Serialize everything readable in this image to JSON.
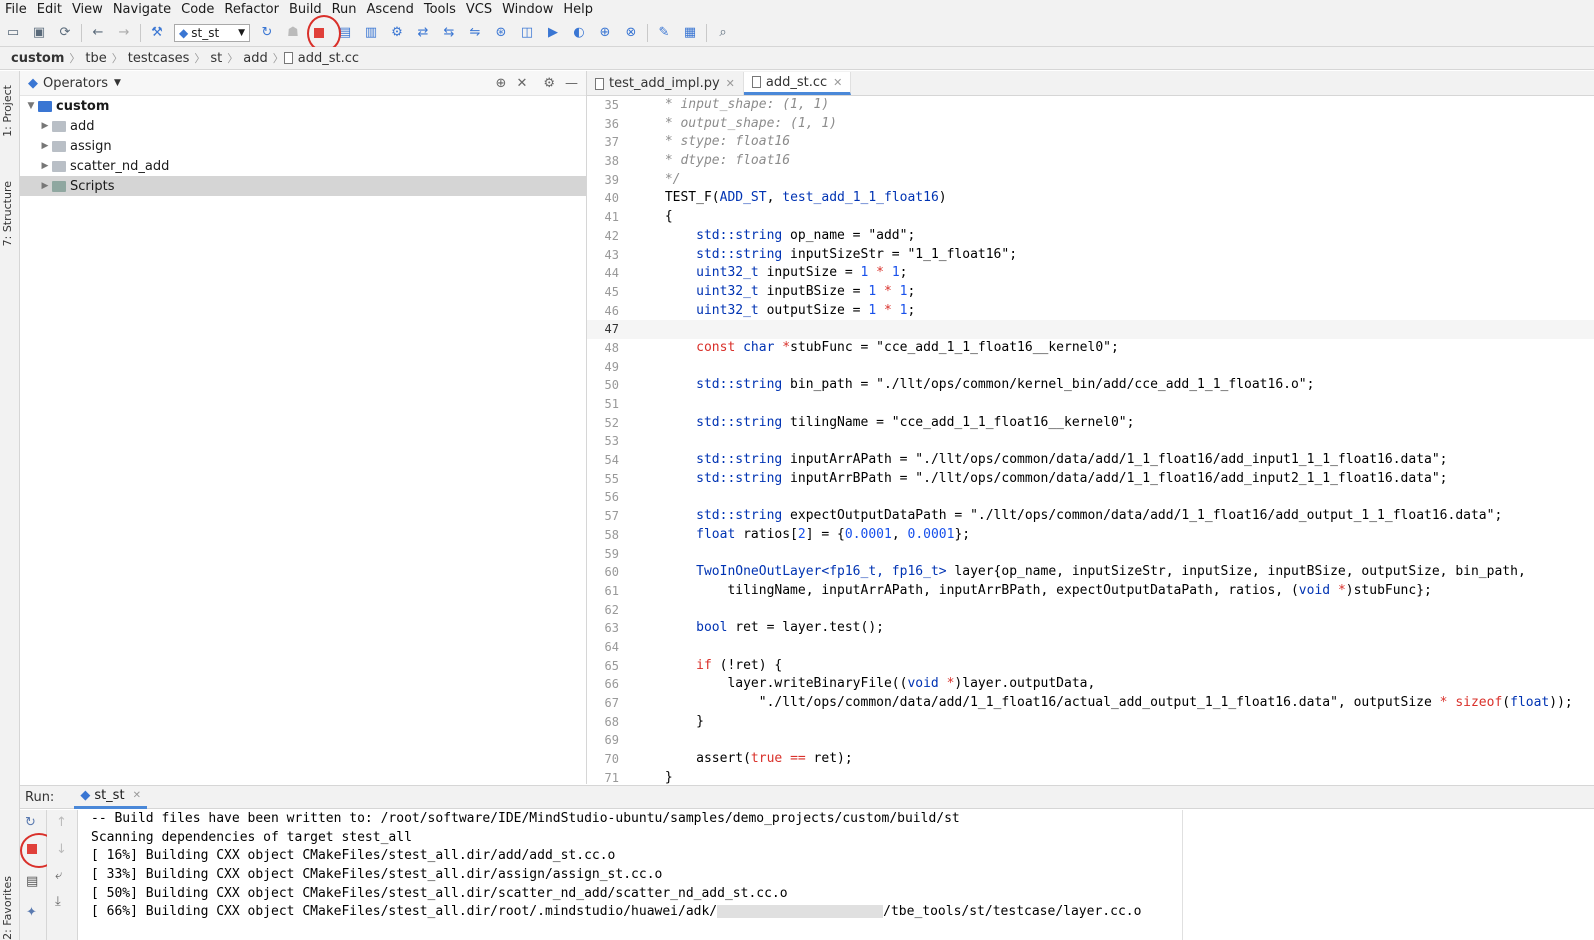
{
  "menu": [
    "File",
    "Edit",
    "View",
    "Navigate",
    "Code",
    "Refactor",
    "Build",
    "Run",
    "Ascend",
    "Tools",
    "VCS",
    "Window",
    "Help"
  ],
  "toolbar": {
    "run_config": "st_st",
    "icons": [
      "open-icon",
      "save-icon",
      "sync-icon",
      "back-icon",
      "forward-icon",
      "build-hammer-icon",
      "run-icon",
      "debug-icon",
      "stop-icon",
      "model-converter-icon",
      "dump-icon",
      "profiling-icon",
      "tuning-icon",
      "plugin-icon",
      "ais-icon",
      "ascend-icon",
      "tracing-icon",
      "sampling-icon",
      "monitor-icon",
      "dev-icon",
      "zoom-icon",
      "settings-wrench-icon",
      "project-structure-icon",
      "search-icon"
    ]
  },
  "breadcrumb": [
    "custom",
    "tbe",
    "testcases",
    "st",
    "add",
    "add_st.cc"
  ],
  "left_strip": {
    "project_tab": "1: Project",
    "structure_tab": "7: Structure",
    "favorites_tab": "2: Favorites"
  },
  "project": {
    "header": "Operators",
    "root": "custom",
    "items": [
      "add",
      "assign",
      "scatter_nd_add",
      "Scripts"
    ]
  },
  "editor": {
    "tabs": [
      "test_add_impl.py",
      "add_st.cc"
    ],
    "lines": [
      {
        "n": "35",
        "html": "<span class='c-cmt'> * input_shape: (1, 1)</span>"
      },
      {
        "n": "36",
        "html": "<span class='c-cmt'> * output_shape: (1, 1)</span>"
      },
      {
        "n": "37",
        "html": "<span class='c-cmt'> * stype: float16</span>"
      },
      {
        "n": "38",
        "html": "<span class='c-cmt'> * dtype: float16</span>"
      },
      {
        "n": "39",
        "html": "<span class='c-cmt'> */</span>"
      },
      {
        "n": "40",
        "html": " TEST_F(<span class='c-type'>ADD_ST</span>, <span class='c-type'>test_add_1_1_float16</span>)"
      },
      {
        "n": "41",
        "html": " {"
      },
      {
        "n": "42",
        "html": "     <span class='c-type'>std::string</span> op_name = \"add\";"
      },
      {
        "n": "43",
        "html": "     <span class='c-type'>std::string</span> inputSizeStr = \"1_1_float16\";"
      },
      {
        "n": "44",
        "html": "     <span class='c-type'>uint32_t</span> inputSize = <span class='c-num'>1</span> <span class='c-kw'>*</span> <span class='c-num'>1</span>;"
      },
      {
        "n": "45",
        "html": "     <span class='c-type'>uint32_t</span> inputBSize = <span class='c-num'>1</span> <span class='c-kw'>*</span> <span class='c-num'>1</span>;"
      },
      {
        "n": "46",
        "html": "     <span class='c-type'>uint32_t</span> outputSize = <span class='c-num'>1</span> <span class='c-kw'>*</span> <span class='c-num'>1</span>;"
      },
      {
        "n": "47",
        "html": "",
        "current": true
      },
      {
        "n": "48",
        "html": "     <span class='c-kw'>const</span> <span class='c-type'>char</span> <span class='c-kw'>*</span>stubFunc = \"cce_add_1_1_float16__kernel0\";"
      },
      {
        "n": "49",
        "html": ""
      },
      {
        "n": "50",
        "html": "     <span class='c-type'>std::string</span> bin_path = \"./llt/ops/common/kernel_bin/add/cce_add_1_1_float16.o\";"
      },
      {
        "n": "51",
        "html": ""
      },
      {
        "n": "52",
        "html": "     <span class='c-type'>std::string</span> tilingName = \"cce_add_1_1_float16__kernel0\";"
      },
      {
        "n": "53",
        "html": ""
      },
      {
        "n": "54",
        "html": "     <span class='c-type'>std::string</span> inputArrAPath = \"./llt/ops/common/data/add/1_1_float16/add_input1_1_1_float16.data\";"
      },
      {
        "n": "55",
        "html": "     <span class='c-type'>std::string</span> inputArrBPath = \"./llt/ops/common/data/add/1_1_float16/add_input2_1_1_float16.data\";"
      },
      {
        "n": "56",
        "html": ""
      },
      {
        "n": "57",
        "html": "     <span class='c-type'>std::string</span> expectOutputDataPath = \"./llt/ops/common/data/add/1_1_float16/add_output_1_1_float16.data\";"
      },
      {
        "n": "58",
        "html": "     <span class='c-type'>float</span> ratios[<span class='c-num'>2</span>] = {<span class='c-num'>0.0001</span>, <span class='c-num'>0.0001</span>};"
      },
      {
        "n": "59",
        "html": ""
      },
      {
        "n": "60",
        "html": "     <span class='c-type'>TwoInOneOutLayer&lt;fp16_t, fp16_t&gt;</span> layer{op_name, inputSizeStr, inputSize, inputBSize, outputSize, bin_path,"
      },
      {
        "n": "61",
        "html": "         tilingName, inputArrAPath, inputArrBPath, expectOutputDataPath, ratios, (<span class='c-type'>void</span> <span class='c-kw'>*</span>)stubFunc};"
      },
      {
        "n": "62",
        "html": ""
      },
      {
        "n": "63",
        "html": "     <span class='c-type'>bool</span> ret = layer.test();"
      },
      {
        "n": "64",
        "html": ""
      },
      {
        "n": "65",
        "html": "     <span class='c-kw'>if</span> (!ret) {"
      },
      {
        "n": "66",
        "html": "         layer.writeBinaryFile((<span class='c-type'>void</span> <span class='c-kw'>*</span>)layer.outputData,"
      },
      {
        "n": "67",
        "html": "             \"./llt/ops/common/data/add/1_1_float16/actual_add_output_1_1_float16.data\", outputSize <span class='c-kw'>*</span> <span class='c-kw'>sizeof</span>(<span class='c-type'>float</span>));"
      },
      {
        "n": "68",
        "html": "     }"
      },
      {
        "n": "69",
        "html": ""
      },
      {
        "n": "70",
        "html": "     assert(<span class='c-kw'>true</span> <span class='c-kw'>==</span> ret);"
      },
      {
        "n": "71",
        "html": " }"
      }
    ]
  },
  "run": {
    "label": "Run:",
    "tab": "st_st",
    "output": [
      "-- Build files have been written to: /root/software/IDE/MindStudio-ubuntu/samples/demo_projects/custom/build/st",
      "Scanning dependencies of target stest_all",
      "[ 16%] Building CXX object CMakeFiles/stest_all.dir/add/add_st.cc.o",
      "[ 33%] Building CXX object CMakeFiles/stest_all.dir/assign/assign_st.cc.o",
      "[ 50%] Building CXX object CMakeFiles/stest_all.dir/scatter_nd_add/scatter_nd_add_st.cc.o"
    ],
    "last_line_prefix": "[ 66%] Building CXX object CMakeFiles/stest_all.dir/root/.mindstudio/huawei/adk/",
    "last_line_suffix": "/tbe_tools/st/testcase/layer.cc.o"
  },
  "colors": {
    "highlight_circle": "#d9302a",
    "accent": "#4a88d8",
    "stop": "#e0403a"
  }
}
